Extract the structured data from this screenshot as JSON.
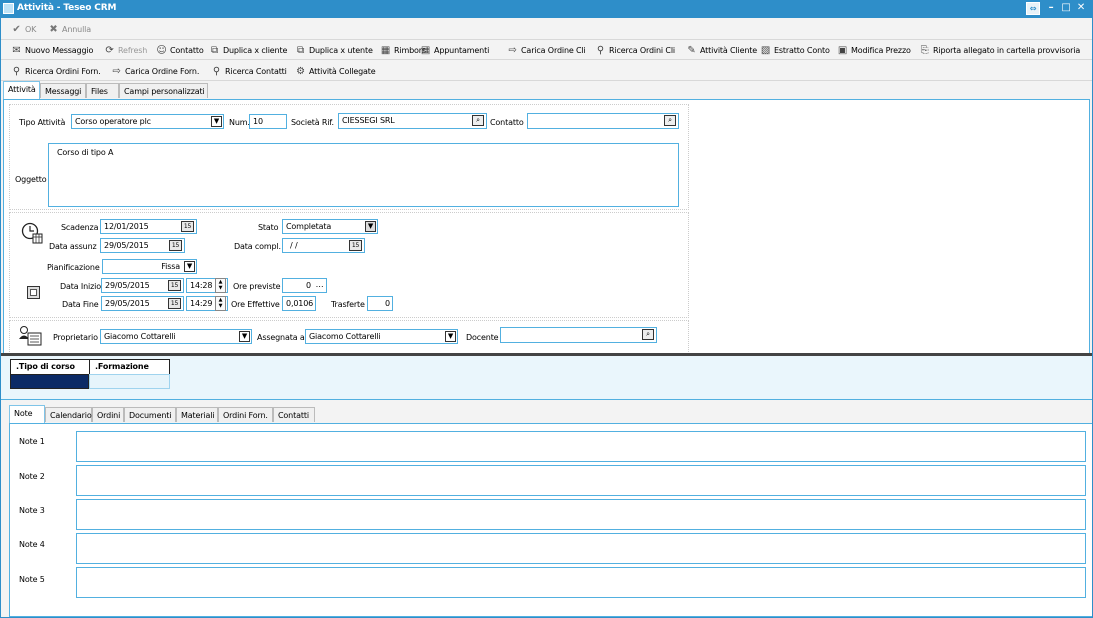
{
  "window": {
    "title": "Attività - Teseo CRM"
  },
  "toolbar1": {
    "ok_label": "OK",
    "annulla_label": "Annulla"
  },
  "toolbar2": [
    {
      "label": "Nuovo Messaggio",
      "icon": "envelope-icon"
    },
    {
      "label": "Refresh",
      "icon": "refresh-icon"
    },
    {
      "label": "Contatto",
      "icon": "contact-icon"
    },
    {
      "label": "Duplica x cliente",
      "icon": "duplicate-icon"
    },
    {
      "label": "Duplica x utente",
      "icon": "duplicate-icon"
    },
    {
      "label": "Rimborsi",
      "icon": "calculator-icon"
    },
    {
      "label": "Appuntamenti",
      "icon": "calendar-icon"
    },
    {
      "label": "Carica Ordine Cli",
      "icon": "arrow-right-icon"
    },
    {
      "label": "Ricerca Ordini Cli",
      "icon": "binoculars-icon"
    },
    {
      "label": "Attività Cliente",
      "icon": "activity-icon"
    },
    {
      "label": "Estratto Conto",
      "icon": "statement-icon"
    },
    {
      "label": "Modifica Prezzo",
      "icon": "price-icon"
    },
    {
      "label": "Riporta allegato in cartella provvisoria",
      "icon": "attachment-icon"
    }
  ],
  "toolbar3": [
    {
      "label": "Ricerca Ordini Forn.",
      "icon": "binoculars-icon"
    },
    {
      "label": "Carica Ordine Forn.",
      "icon": "arrow-right-icon"
    },
    {
      "label": "Ricerca Contatti",
      "icon": "binoculars-icon"
    },
    {
      "label": "Attività Collegate",
      "icon": "linked-activity-icon"
    }
  ],
  "main_tabs": [
    "Attività",
    "Messaggi",
    "Files",
    "Campi personalizzati"
  ],
  "form": {
    "tipo_attivita_label": "Tipo Attività",
    "tipo_attivita_value": "Corso operatore plc",
    "num_label": "Num.",
    "num_value": "10",
    "societa_label": "Società Rif.",
    "societa_value": "CIESSEGI SRL",
    "contatto_label": "Contatto",
    "contatto_value": "",
    "oggetto_label": "Oggetto",
    "oggetto_value": "Corso di tipo A",
    "scadenza_label": "Scadenza",
    "scadenza_value": "12/01/2015",
    "stato_label": "Stato",
    "stato_value": "Completata",
    "data_assunz_label": "Data assunz",
    "data_assunz_value": "29/05/2015",
    "data_compl_label": "Data compl.",
    "data_compl_value": "/ /",
    "pianificazione_label": "Pianificazione",
    "pianificazione_value": "Fissa",
    "data_inizio_label": "Data Inizio",
    "data_inizio_value": "29/05/2015",
    "ora_inizio_value": "14:28",
    "ore_previste_label": "Ore previste",
    "ore_previste_value": "0",
    "data_fine_label": "Data Fine",
    "data_fine_value": "29/05/2015",
    "ora_fine_value": "14:29",
    "ore_effettive_label": "Ore Effettive",
    "ore_effettive_value": "0,0106",
    "trasferte_label": "Trasferte",
    "trasferte_value": "0",
    "proprietario_label": "Proprietario",
    "proprietario_value": "Giacomo Cottarelli",
    "assegnata_label": "Assegnata a",
    "assegnata_value": "Giacomo Cottarelli",
    "docente_label": "Docente",
    "docente_value": ""
  },
  "grid": {
    "headers": [
      ".Tipo di corso",
      ".Formazione"
    ],
    "selected_color": "#0b2a66"
  },
  "bottom_tabs": [
    "Note",
    "Calendario",
    "Ordini",
    "Documenti",
    "Materiali",
    "Ordini Forn.",
    "Contatti"
  ],
  "notes": [
    {
      "label": "Note 1",
      "value": ""
    },
    {
      "label": "Note 2",
      "value": ""
    },
    {
      "label": "Note 3",
      "value": ""
    },
    {
      "label": "Note 4",
      "value": ""
    },
    {
      "label": "Note 5",
      "value": ""
    }
  ],
  "colors": {
    "accent": "#2e8ec9",
    "field_border": "#52b0e0",
    "grid_bg": "#eaf6fc"
  }
}
